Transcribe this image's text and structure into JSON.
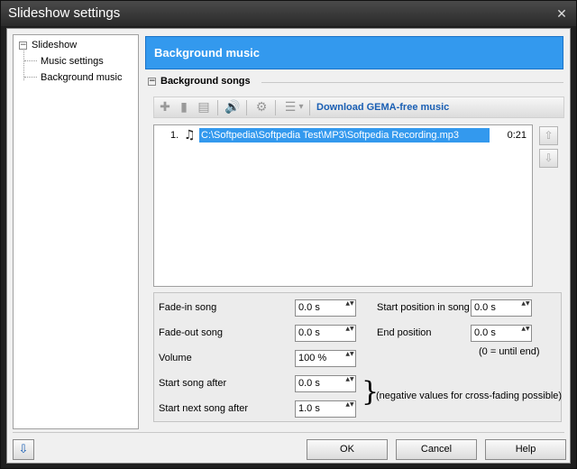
{
  "window": {
    "title": "Slideshow settings",
    "close_glyph": "✕"
  },
  "tree": {
    "root": {
      "label": "Slideshow",
      "toggle": "−"
    },
    "children": [
      {
        "label": "Music settings"
      },
      {
        "label": "Background music"
      }
    ]
  },
  "header": {
    "title": "Background music"
  },
  "section": {
    "title": "Background songs",
    "toggle": "−"
  },
  "toolbar": {
    "icons": [
      "add-icon",
      "delete-icon",
      "edit-icon",
      "volume-icon",
      "sound-settings-icon",
      "list-view-icon"
    ],
    "glyphs": {
      "add": "✚",
      "delete": "▮",
      "edit": "▤",
      "volume": "🔊",
      "sound_settings": "⚙",
      "list_view": "☰",
      "dropdown": "▾"
    },
    "download_link": "Download GEMA-free music"
  },
  "songs": [
    {
      "number": "1.",
      "path": "C:\\Softpedia\\Softpedia Test\\MP3\\Softpedia Recording.mp3",
      "duration": "0:21",
      "icon": "♫"
    }
  ],
  "side_buttons": {
    "up": "⇧",
    "down": "⇩"
  },
  "settings": {
    "fade_in_label": "Fade-in song",
    "fade_in_value": "0.0 s",
    "fade_out_label": "Fade-out song",
    "fade_out_value": "0.0 s",
    "volume_label": "Volume",
    "volume_value": "100 %",
    "start_song_after_label": "Start song after",
    "start_song_after_value": "0.0 s",
    "start_next_label": "Start next song after",
    "start_next_value": "1.0 s",
    "start_position_label": "Start position in song",
    "start_position_value": "0.0 s",
    "end_position_label": "End position",
    "end_position_value": "0.0 s",
    "end_note": "(0 = until end)",
    "crossfade_note": "(negative values for cross-fading possible)",
    "brace": "}",
    "spin_arrows": "▲▼"
  },
  "buttons": {
    "help_icon": "⇩",
    "ok": "OK",
    "cancel": "Cancel",
    "help": "Help"
  },
  "colors": {
    "accent": "#3399ee",
    "link": "#1a5fb4"
  }
}
